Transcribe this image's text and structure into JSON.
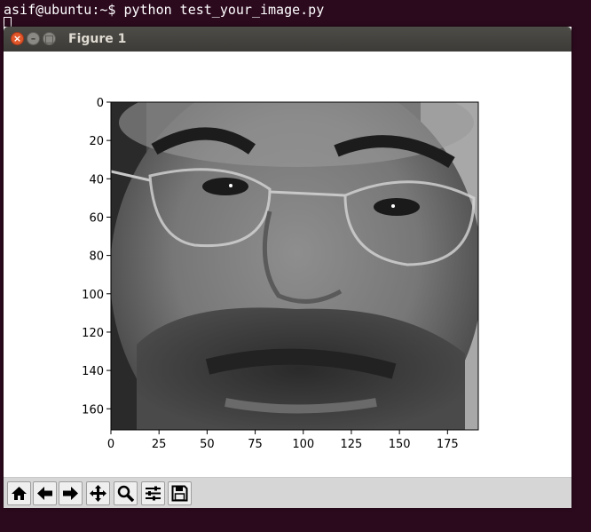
{
  "terminal": {
    "prompt": "asif@ubuntu:~$",
    "command": "python test_your_image.py"
  },
  "window": {
    "title": "Figure 1",
    "controls": {
      "close": "×",
      "minimize": "–",
      "maximize": "□"
    }
  },
  "figure": {
    "image": "grayscale face photograph",
    "y_ticks": [
      "0",
      "20",
      "40",
      "60",
      "80",
      "100",
      "120",
      "140",
      "160"
    ],
    "x_ticks": [
      "0",
      "25",
      "50",
      "75",
      "100",
      "125",
      "150",
      "175"
    ],
    "xlim": [
      0,
      191
    ],
    "ylim": [
      0,
      171
    ]
  },
  "toolbar": {
    "buttons": [
      {
        "name": "home",
        "icon": "home-icon"
      },
      {
        "name": "back",
        "icon": "arrow-left-icon"
      },
      {
        "name": "forward",
        "icon": "arrow-right-icon"
      },
      {
        "name": "pan",
        "icon": "move-icon"
      },
      {
        "name": "zoom",
        "icon": "zoom-icon"
      },
      {
        "name": "configure-subplots",
        "icon": "sliders-icon"
      },
      {
        "name": "save",
        "icon": "save-icon"
      }
    ]
  }
}
